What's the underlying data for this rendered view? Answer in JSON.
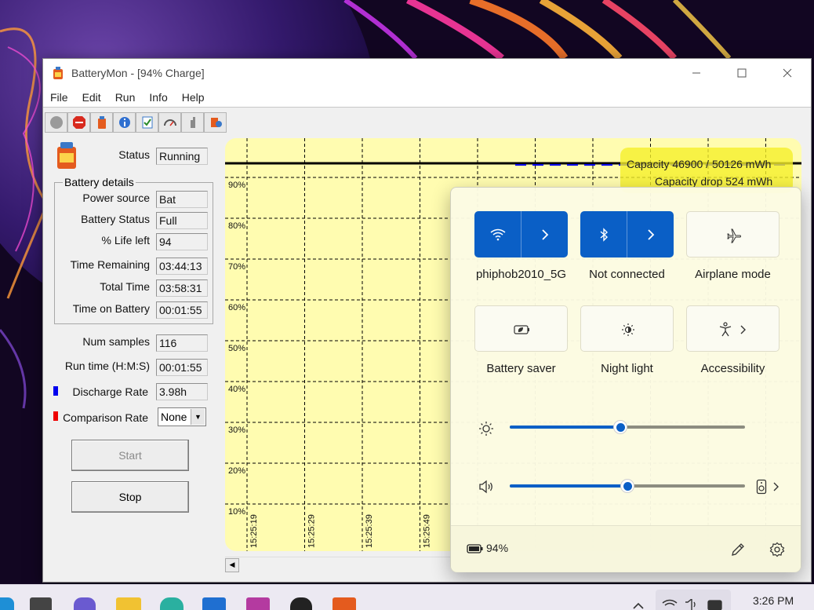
{
  "window": {
    "title": "BatteryMon - [94% Charge]",
    "menu": [
      "File",
      "Edit",
      "Run",
      "Info",
      "Help"
    ],
    "toolbar_icons": [
      "stop-circle-icon",
      "stop-sign-icon",
      "battery-icon",
      "info-icon",
      "checklist-icon",
      "gauge-icon",
      "hand-icon",
      "settings-icon"
    ]
  },
  "panel": {
    "status_label": "Status",
    "status_value": "Running",
    "group_title": "Battery details",
    "details": [
      {
        "label": "Power source",
        "value": "Bat"
      },
      {
        "label": "Battery Status",
        "value": "Full"
      },
      {
        "label": "% Life left",
        "value": "94"
      },
      {
        "label": "Time Remaining",
        "value": "03:44:13"
      },
      {
        "label": "Total Time",
        "value": "03:58:31"
      },
      {
        "label": "Time on Battery",
        "value": "00:01:55"
      }
    ],
    "num_samples_label": "Num samples",
    "num_samples_value": "116",
    "run_time_label": "Run time (H:M:S)",
    "run_time_value": "00:01:55",
    "discharge_label": "Discharge Rate",
    "discharge_value": "3.98h",
    "comparison_label": "Comparison Rate",
    "comparison_value": "None",
    "start_label": "Start",
    "stop_label": "Stop"
  },
  "chart_data": {
    "type": "line",
    "y_ticks": [
      "90%",
      "80%",
      "70%",
      "60%",
      "50%",
      "40%",
      "30%",
      "20%",
      "10%"
    ],
    "x_ticks": [
      "15:25:19",
      "15:25:29",
      "15:25:39",
      "15:25:49"
    ],
    "ylim": [
      0,
      100
    ],
    "series": [
      {
        "name": "Capacity",
        "values": [
          94,
          94,
          94,
          94,
          94,
          94,
          94,
          94,
          94,
          94
        ],
        "color": "#000000"
      },
      {
        "name": "Discharge",
        "values": [
          94,
          94,
          94,
          94,
          94,
          94
        ],
        "color": "#0000ee"
      }
    ],
    "annotations": [
      "Capacity 46900 / 50126 mWh",
      "Capacity drop 524 mWh"
    ],
    "grid": true
  },
  "quick_settings": {
    "tiles": [
      {
        "label": "phiphob2010_5G",
        "icon": "wifi-icon",
        "active": true,
        "expand": true
      },
      {
        "label": "Not connected",
        "icon": "bluetooth-icon",
        "active": true,
        "expand": true
      },
      {
        "label": "Airplane mode",
        "icon": "airplane-icon",
        "active": false,
        "expand": false
      },
      {
        "label": "Battery saver",
        "icon": "battery-saver-icon",
        "active": false,
        "expand": false
      },
      {
        "label": "Night light",
        "icon": "night-light-icon",
        "active": false,
        "expand": false
      },
      {
        "label": "Accessibility",
        "icon": "accessibility-icon",
        "active": false,
        "expand": true
      }
    ],
    "brightness": 0.47,
    "volume": 0.5,
    "battery_percent": "94%"
  },
  "taskbar": {
    "time": "3:26 PM"
  },
  "colors": {
    "accent": "#0a5fc6",
    "chart_bg": "#fffcb0",
    "discharge": "#0000ee",
    "comparison": "#ee0000"
  }
}
